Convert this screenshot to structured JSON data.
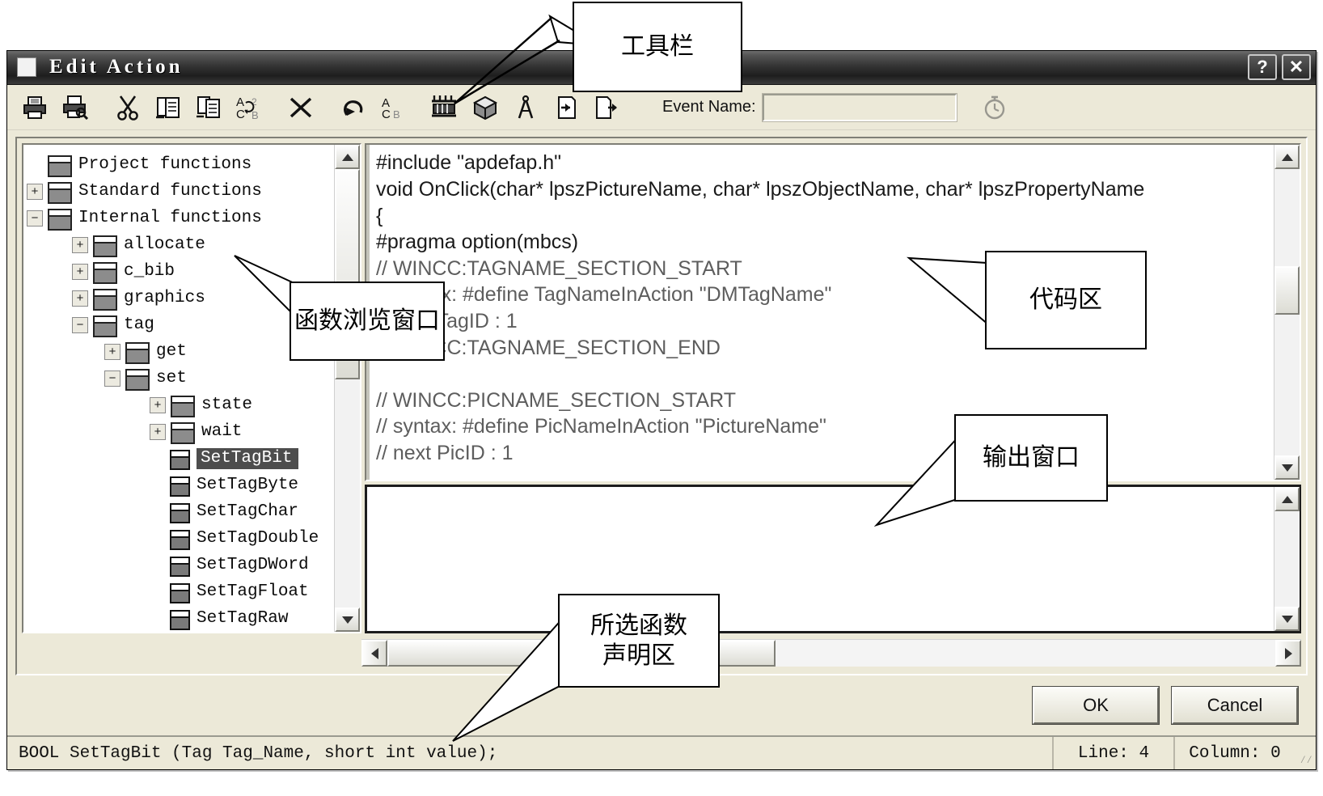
{
  "window": {
    "title": "Edit Action",
    "help_button": "?",
    "close_button": "✕"
  },
  "toolbar": {
    "items": [
      {
        "name": "print-icon",
        "label": "Print"
      },
      {
        "name": "print-preview-icon",
        "label": "Print Preview"
      },
      {
        "name": "cut-icon",
        "label": "Cut"
      },
      {
        "name": "copy-icon",
        "label": "Copy"
      },
      {
        "name": "paste-icon",
        "label": "Paste"
      },
      {
        "name": "replace-icon",
        "label": "Replace"
      },
      {
        "name": "delete-icon",
        "label": "Delete"
      },
      {
        "name": "undo-icon",
        "label": "Undo"
      },
      {
        "name": "match-case-icon",
        "label": "Match Case"
      },
      {
        "name": "compile-icon",
        "label": "Compile"
      },
      {
        "name": "package-icon",
        "label": "Object"
      },
      {
        "name": "compass-icon",
        "label": "Check"
      },
      {
        "name": "import-icon",
        "label": "Import"
      },
      {
        "name": "export-icon",
        "label": "Export"
      }
    ],
    "event_name_label": "Event Name:",
    "event_name_value": "",
    "event_name_placeholder": "",
    "timer_icon": "timer-icon"
  },
  "tree": {
    "nodes": [
      {
        "label": "Project functions",
        "expander": "",
        "indent": 0,
        "icon": "folder",
        "selected": false
      },
      {
        "label": "Standard functions",
        "expander": "+",
        "indent": 0,
        "icon": "folder",
        "selected": false
      },
      {
        "label": "Internal functions",
        "expander": "−",
        "indent": 0,
        "icon": "folder",
        "selected": false
      },
      {
        "label": "allocate",
        "expander": "+",
        "indent": 1,
        "icon": "folder",
        "selected": false
      },
      {
        "label": "c_bib",
        "expander": "+",
        "indent": 1,
        "icon": "folder",
        "selected": false
      },
      {
        "label": "graphics",
        "expander": "+",
        "indent": 1,
        "icon": "folder",
        "selected": false
      },
      {
        "label": "tag",
        "expander": "−",
        "indent": 1,
        "icon": "folder",
        "selected": false
      },
      {
        "label": "get",
        "expander": "+",
        "indent": 2,
        "icon": "folder",
        "selected": false
      },
      {
        "label": "set",
        "expander": "−",
        "indent": 2,
        "icon": "folder",
        "selected": false
      },
      {
        "label": "state",
        "expander": "+",
        "indent": 3,
        "icon": "folder",
        "selected": false
      },
      {
        "label": "wait",
        "expander": "+",
        "indent": 3,
        "icon": "folder",
        "selected": false
      },
      {
        "label": "SetTagBit",
        "expander": "",
        "indent": 3,
        "icon": "func",
        "selected": true
      },
      {
        "label": "SetTagByte",
        "expander": "",
        "indent": 3,
        "icon": "func",
        "selected": false
      },
      {
        "label": "SetTagChar",
        "expander": "",
        "indent": 3,
        "icon": "func",
        "selected": false
      },
      {
        "label": "SetTagDouble",
        "expander": "",
        "indent": 3,
        "icon": "func",
        "selected": false
      },
      {
        "label": "SetTagDWord",
        "expander": "",
        "indent": 3,
        "icon": "func",
        "selected": false
      },
      {
        "label": "SetTagFloat",
        "expander": "",
        "indent": 3,
        "icon": "func",
        "selected": false
      },
      {
        "label": "SetTagRaw",
        "expander": "",
        "indent": 3,
        "icon": "func",
        "selected": false
      }
    ]
  },
  "code": {
    "lines": [
      {
        "text": "#include \"apdefap.h\"",
        "dim": false
      },
      {
        "text": "void OnClick(char* lpszPictureName, char* lpszObjectName, char* lpszPropertyName",
        "dim": false
      },
      {
        "text": "{",
        "dim": false
      },
      {
        "text": "#pragma option(mbcs)",
        "dim": false
      },
      {
        "text": "// WINCC:TAGNAME_SECTION_START",
        "dim": true
      },
      {
        "text": "// syntax: #define TagNameInAction \"DMTagName\"",
        "dim": true
      },
      {
        "text": "// next TagID : 1",
        "dim": true
      },
      {
        "text": "// WINCC:TAGNAME_SECTION_END",
        "dim": true
      },
      {
        "text": "",
        "dim": true
      },
      {
        "text": "// WINCC:PICNAME_SECTION_START",
        "dim": true
      },
      {
        "text": "// syntax: #define PicNameInAction \"PictureName\"",
        "dim": true
      },
      {
        "text": "// next PicID : 1",
        "dim": true
      }
    ]
  },
  "output": {
    "text": ""
  },
  "buttons": {
    "ok": "OK",
    "cancel": "Cancel"
  },
  "statusbar": {
    "declaration": "BOOL SetTagBit (Tag Tag_Name, short int value);",
    "line": "Line: 4",
    "column": "Column: 0"
  },
  "annotations": {
    "toolbar": "工具栏",
    "function_browser": "函数浏览窗口",
    "code_area": "代码区",
    "output_window": "输出窗口",
    "declaration_area": "所选函数\n声明区"
  },
  "colors": {
    "titlebar": "#2b2b2b",
    "dialog_face": "#ece9d8",
    "selection": "#4d4d4d",
    "code_dim": "#5d5d5d"
  }
}
